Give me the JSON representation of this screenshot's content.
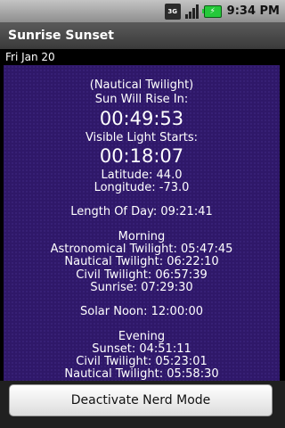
{
  "status_bar": {
    "network": "3G",
    "time": "9:34 PM",
    "icons": [
      "network-3g-icon",
      "signal-bars-icon",
      "battery-charging-icon"
    ]
  },
  "app_title": "Sunrise Sunset",
  "date": "Fri Jan 20",
  "info": {
    "twilight_label": "(Nautical Twilight)",
    "rise_label": "Sun Will Rise In:",
    "rise_countdown": "00:49:53",
    "visible_label": "Visible Light Starts:",
    "visible_countdown": "00:18:07",
    "latitude": "Latitude: 44.0",
    "longitude": "Longitude: -73.0",
    "length_of_day": "Length Of Day: 09:21:41",
    "morning": {
      "heading": "Morning",
      "astronomical": "Astronomical Twilight: 05:47:45",
      "nautical": "Nautical Twilight: 06:22:10",
      "civil": "Civil Twilight: 06:57:39",
      "sunrise": "Sunrise: 07:29:30"
    },
    "solar_noon": "Solar Noon: 12:00:00",
    "evening": {
      "heading": "Evening",
      "sunset": "Sunset: 04:51:11",
      "civil": "Civil Twilight: 05:23:01",
      "nautical": "Nautical Twilight: 05:58:30"
    }
  },
  "button_label": "Deactivate Nerd Mode",
  "colors": {
    "content_bg": "#2f1869",
    "battery": "#25c93a"
  }
}
